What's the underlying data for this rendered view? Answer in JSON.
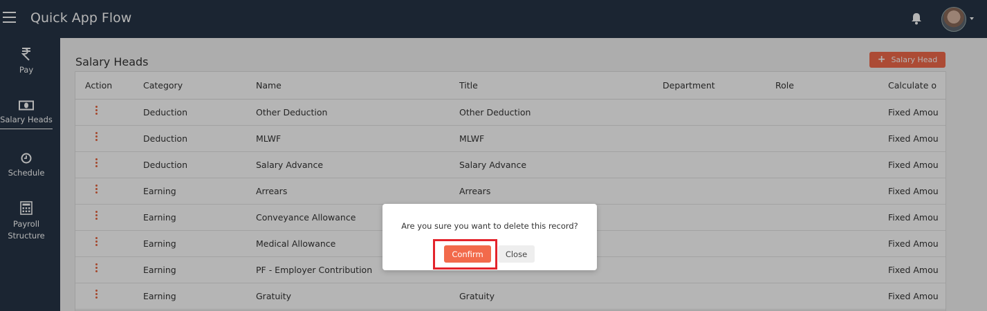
{
  "app": {
    "title": "Quick App Flow"
  },
  "sidebar": {
    "items": [
      {
        "label": "Pay",
        "icon": "rupee-icon"
      },
      {
        "label": "Salary Heads",
        "icon": "money-icon",
        "active": true
      },
      {
        "label": "Schedule",
        "icon": "clock-icon"
      },
      {
        "label": "Payroll Structure",
        "label_line1": "Payroll",
        "label_line2": "Structure",
        "icon": "calculator-icon"
      }
    ]
  },
  "page": {
    "title": "Salary Heads",
    "add_button_label": "Salary Head"
  },
  "table": {
    "columns": [
      "Action",
      "Category",
      "Name",
      "Title",
      "Department",
      "Role",
      "Calculate o"
    ],
    "rows": [
      {
        "category": "Deduction",
        "name": "Other Deduction",
        "title": "Other Deduction",
        "department": "",
        "role": "",
        "calculate": "Fixed Amou"
      },
      {
        "category": "Deduction",
        "name": "MLWF",
        "title": "MLWF",
        "department": "",
        "role": "",
        "calculate": "Fixed Amou"
      },
      {
        "category": "Deduction",
        "name": "Salary Advance",
        "title": "Salary Advance",
        "department": "",
        "role": "",
        "calculate": "Fixed Amou"
      },
      {
        "category": "Earning",
        "name": "Arrears",
        "title": "Arrears",
        "department": "",
        "role": "",
        "calculate": "Fixed Amou"
      },
      {
        "category": "Earning",
        "name": "Conveyance Allowance",
        "title": "",
        "department": "",
        "role": "",
        "calculate": "Fixed Amou"
      },
      {
        "category": "Earning",
        "name": "Medical Allowance",
        "title": "",
        "department": "",
        "role": "",
        "calculate": "Fixed Amou"
      },
      {
        "category": "Earning",
        "name": "PF - Employer Contribution",
        "title": "",
        "department": "",
        "role": "",
        "calculate": "Fixed Amou"
      },
      {
        "category": "Earning",
        "name": "Gratuity",
        "title": "Gratuity",
        "department": "",
        "role": "",
        "calculate": "Fixed Amou"
      }
    ]
  },
  "modal": {
    "message": "Are you sure you want to delete this record?",
    "confirm_label": "Confirm",
    "close_label": "Close"
  },
  "colors": {
    "topbar": "#263547",
    "accent": "#f26a4b",
    "highlight": "#e3232b"
  }
}
